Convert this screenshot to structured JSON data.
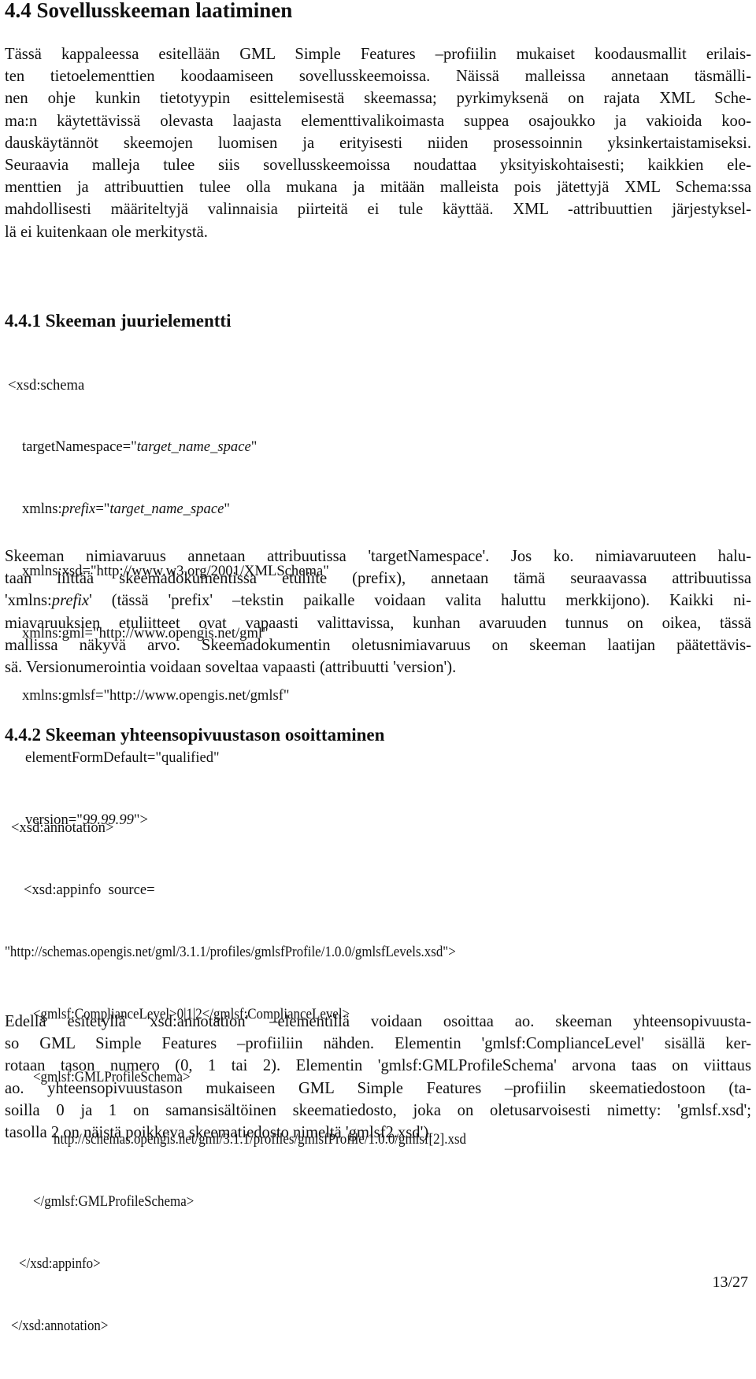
{
  "section": {
    "heading": "4.4  Sovellusskeeman laatiminen",
    "intro_lines": [
      "Tässä kappaleessa esitellään GML Simple Features –profiilin mukaiset koodausmallit erilais-",
      "ten tietoelementtien koodaamiseen sovellusskeemoissa. Näissä malleissa annetaan täsmälli-",
      "nen ohje kunkin tietotyypin esittelemisestä skeemassa; pyrkimyksenä on rajata XML Sche-",
      "ma:n käytettävissä olevasta laajasta elementtivalikoimasta suppea osajoukko ja vakioida koo-",
      "dauskäytännöt skeemojen luomisen ja erityisesti niiden prosessoinnin yksinkertaistamiseksi.",
      "Seuraavia malleja tulee siis sovellusskeemoissa noudattaa yksityiskohtaisesti; kaikkien ele-",
      "menttien ja attribuuttien tulee olla mukana ja mitään malleista pois jätettyjä XML Schema:ssa",
      "mahdollisesti määriteltyjä valinnaisia piirteitä ei tule käyttää. XML -attribuuttien järjestyksel-",
      "lä ei kuitenkaan ole merkitystä."
    ]
  },
  "subsection1": {
    "heading": "4.4.1  Skeeman juurielementti",
    "code": {
      "l1": "<xsd:schema",
      "l2_pre": "targetNamespace=\"",
      "l2_it": "target_name_space",
      "l2_post": "\"",
      "l3_pre": "xmlns:",
      "l3_it1": "prefix",
      "l3_mid": "=\"",
      "l3_it2": "target_name_space",
      "l3_post": "\"",
      "l4": "xmlns:xsd=\"http://www.w3.org/2001/XMLSchema\"",
      "l5": "xmlns:gml=\"http://www.opengis.net/gml\"",
      "l6": "xmlns:gmlsf=\"http://www.opengis.net/gmlsf\"",
      "l7": "elementFormDefault=\"qualified\"",
      "l8_pre": "version=\"",
      "l8_it": "99.99.99",
      "l8_post": "\">"
    },
    "para": {
      "l1": "Skeeman nimiavaruus annetaan attribuutissa 'targetNamespace'. Jos ko. nimiavaruuteen halu-",
      "l2": "taan liittää skeemadokumentissa etuliite (prefix), annetaan tämä seuraavassa attribuutissa",
      "l3_a": "'xmlns:",
      "l3_it": "prefix",
      "l3_b": "' (tässä 'prefix' –tekstin paikalle voidaan valita haluttu merkkijono). Kaikki ni-",
      "l4": "miavaruuksien etuliitteet ovat vapaasti valittavissa, kunhan avaruuden tunnus on oikea, tässä",
      "l5": "mallissa näkyvä arvo. Skeemadokumentin oletusnimiavaruus on skeeman laatijan päätettävis-",
      "l6": "sä. Versionumerointia voidaan soveltaa vapaasti (attribuutti 'version')."
    }
  },
  "subsection2": {
    "heading": "4.4.2  Skeeman yhteensopivuustason osoittaminen",
    "code_lines": [
      "<xsd:annotation>",
      "<xsd:appinfo  source=",
      "\"http://schemas.opengis.net/gml/3.1.1/profiles/gmlsfProfile/1.0.0/gmlsfLevels.xsd\">",
      "<gmlsf:ComplianceLevel>0|1|2</gmlsf:ComplianceLevel>",
      "<gmlsf:GMLProfileSchema>",
      "http://schemas.opengis.net/gml/3.1.1/profiles/gmlsfProfile/1.0.0/gmlsf[2].xsd",
      "</gmlsf:GMLProfileSchema>",
      "</xsd:appinfo>",
      "</xsd:annotation>"
    ],
    "para_lines": [
      "Edellä esitetyllä 'xsd:annotation' –elementillä voidaan osoittaa ao. skeeman yhteensopivuusta-",
      "so GML Simple Features –profiiliin nähden. Elementin 'gmlsf:ComplianceLevel' sisällä ker-",
      "rotaan tason numero (0, 1 tai 2). Elementin 'gmlsf:GMLProfileSchema' arvona taas on viittaus",
      "ao. yhteensopivuustason mukaiseen GML Simple Features –profiilin skeematiedostoon (ta-",
      "soilla 0 ja 1 on samansisältöinen skeematiedosto, joka on oletusarvoisesti nimetty: 'gmlsf.xsd';",
      "tasolla 2 on näistä poikkeva skeematiedosto nimeltä 'gmlsf2.xsd')."
    ]
  },
  "footer": {
    "page_number": "13/27"
  }
}
